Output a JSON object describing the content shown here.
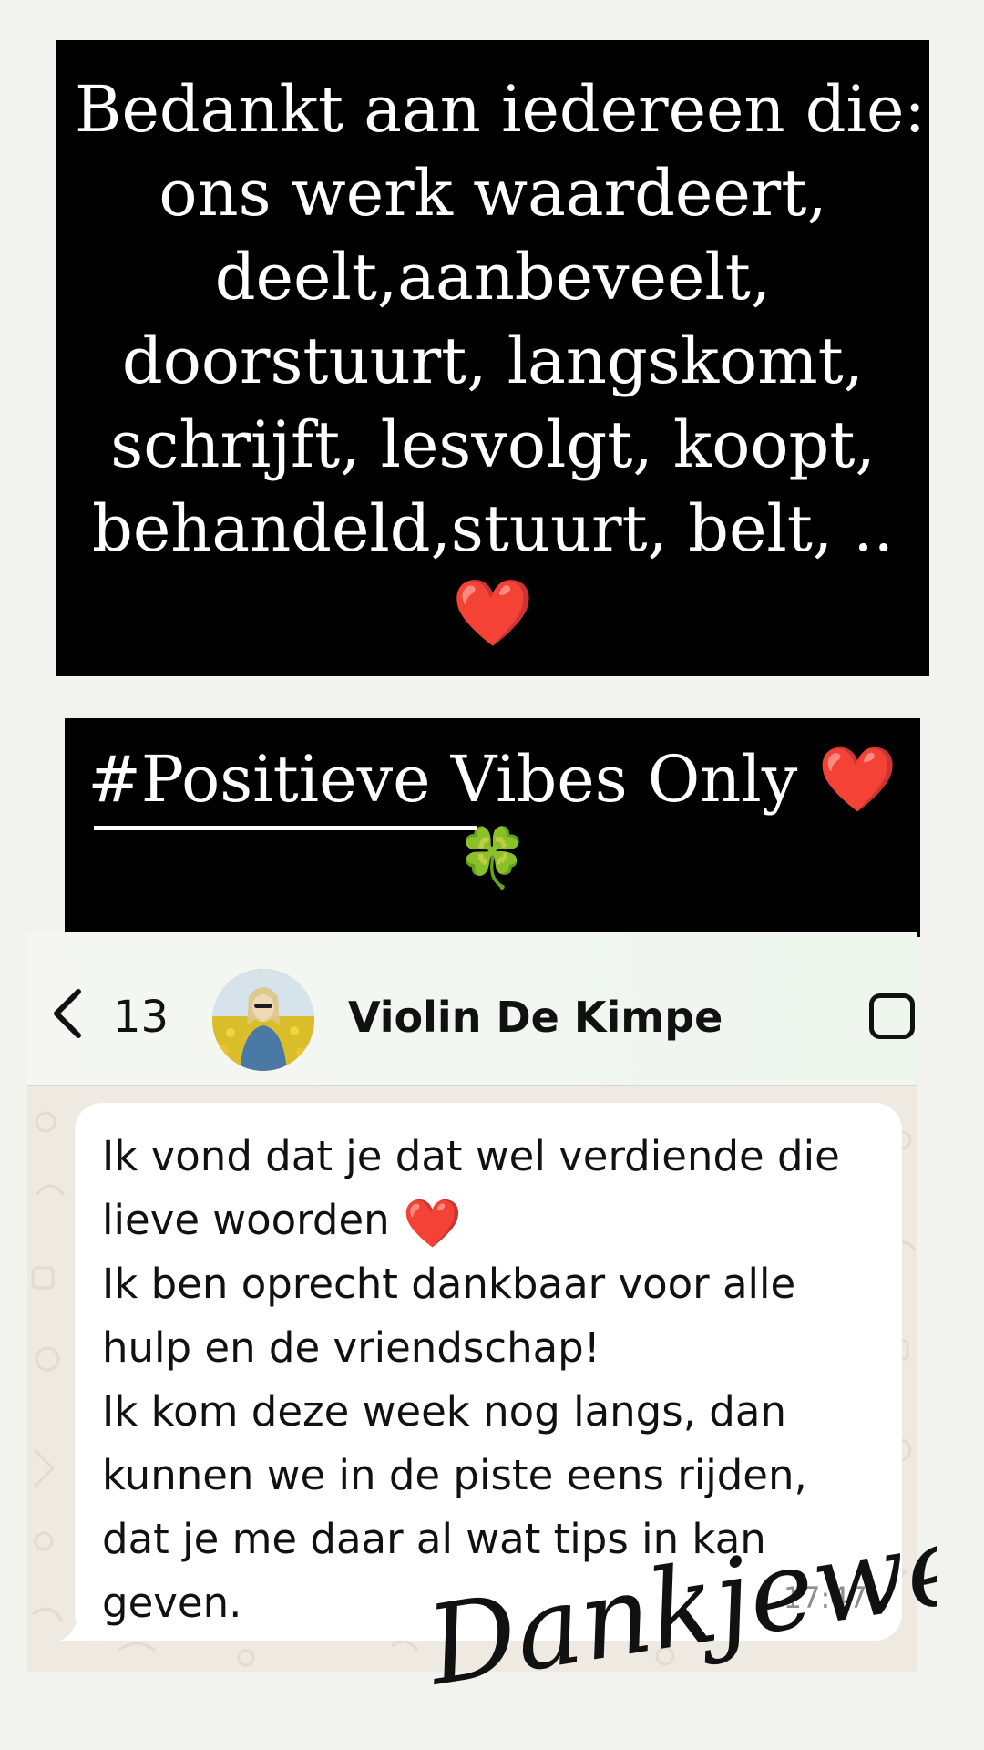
{
  "message1": {
    "lines": [
      "Bedankt aan iedereen die:",
      "ons werk waardeert,",
      "deelt,aanbeveelt,",
      "doorstuurt, langskomt,",
      "schrijft, lesvolgt, koopt,",
      "behandeld,stuurt, belt, .."
    ],
    "emoji": "❤️"
  },
  "message2": {
    "line1": "#Positieve Vibes Only",
    "heart": "❤️",
    "clover": "🍀"
  },
  "chat": {
    "back_count": "13",
    "contact_name": "Violin De Kimpe",
    "message_lines": [
      "Ik vond dat je dat wel verdiende die",
      "lieve woorden",
      "Ik ben oprecht dankbaar voor alle",
      "hulp en de vriendschap!",
      "Ik kom deze week nog langs, dan",
      "kunnen we in de piste eens rijden,",
      "dat je me daar al wat tips in kan",
      "geven."
    ],
    "message_heart": "❤️",
    "timestamp": "17:47",
    "icons": [
      "chevron-left-icon",
      "avatar-photo",
      "square-icon"
    ]
  },
  "signature": {
    "text": "Dankjewel"
  },
  "colors": {
    "page_background": "#f2f3ef",
    "block_background": "#000000",
    "bubble_background": "#ffffff",
    "chat_background": "#efeae1",
    "heart": "#e01e1e",
    "clover": "#2fa53a"
  }
}
